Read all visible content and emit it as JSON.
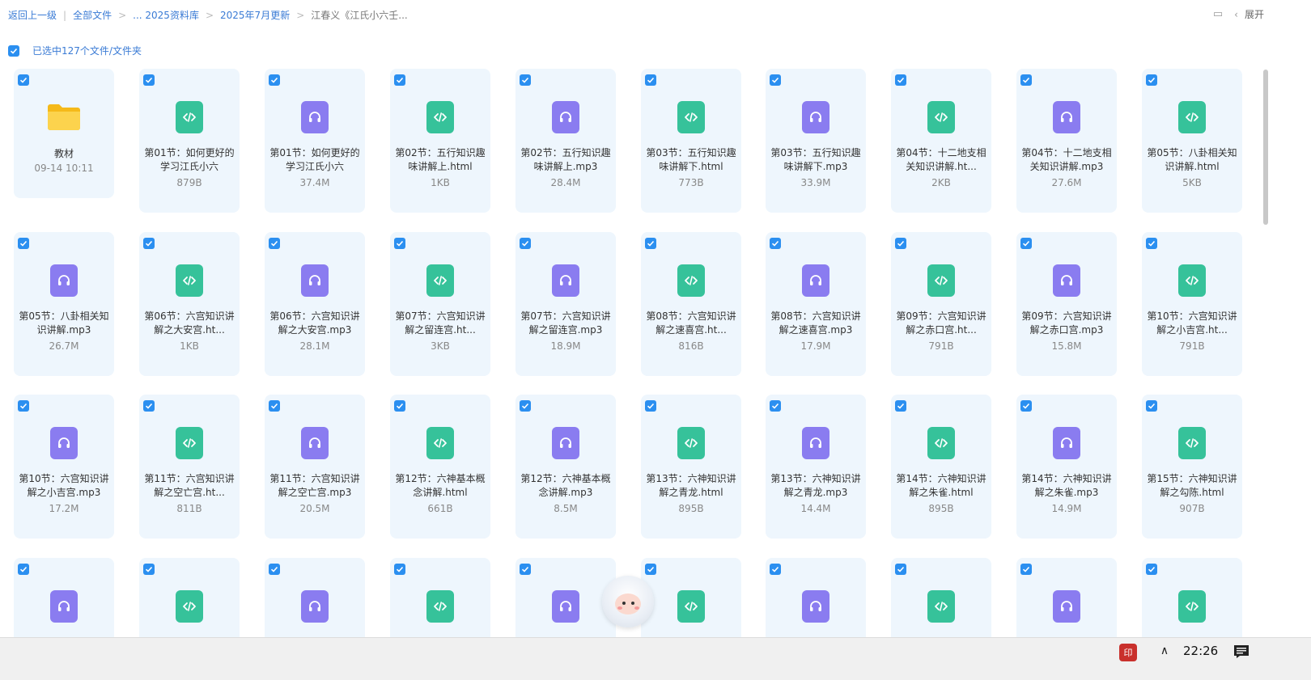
{
  "breadcrumb": {
    "back": "返回上一级",
    "all_files": "全部文件",
    "library": "... 2025资料库",
    "update": "2025年7月更新",
    "current": "江春义《江氏小六壬..."
  },
  "header": {
    "expand_label": "展开"
  },
  "selection": {
    "label": "已选中127个文件/文件夹"
  },
  "files": [
    {
      "type": "folder",
      "name": "教材",
      "meta": "09-14 10:11"
    },
    {
      "type": "html",
      "name": "第01节：如何更好的学习江氏小六",
      "meta": "879B"
    },
    {
      "type": "mp3",
      "name": "第01节：如何更好的学习江氏小六",
      "meta": "37.4M"
    },
    {
      "type": "html",
      "name": "第02节：五行知识趣味讲解上.html",
      "meta": "1KB"
    },
    {
      "type": "mp3",
      "name": "第02节：五行知识趣味讲解上.mp3",
      "meta": "28.4M"
    },
    {
      "type": "html",
      "name": "第03节：五行知识趣味讲解下.html",
      "meta": "773B"
    },
    {
      "type": "mp3",
      "name": "第03节：五行知识趣味讲解下.mp3",
      "meta": "33.9M"
    },
    {
      "type": "html",
      "name": "第04节：十二地支相关知识讲解.ht...",
      "meta": "2KB"
    },
    {
      "type": "mp3",
      "name": "第04节：十二地支相关知识讲解.mp3",
      "meta": "27.6M"
    },
    {
      "type": "html",
      "name": "第05节：八卦相关知识讲解.html",
      "meta": "5KB"
    },
    {
      "type": "mp3",
      "name": "第05节：八卦相关知识讲解.mp3",
      "meta": "26.7M"
    },
    {
      "type": "html",
      "name": "第06节：六宫知识讲解之大安宫.ht...",
      "meta": "1KB"
    },
    {
      "type": "mp3",
      "name": "第06节：六宫知识讲解之大安宫.mp3",
      "meta": "28.1M"
    },
    {
      "type": "html",
      "name": "第07节：六宫知识讲解之留连宫.ht...",
      "meta": "3KB"
    },
    {
      "type": "mp3",
      "name": "第07节：六宫知识讲解之留连宫.mp3",
      "meta": "18.9M"
    },
    {
      "type": "html",
      "name": "第08节：六宫知识讲解之速喜宫.ht...",
      "meta": "816B"
    },
    {
      "type": "mp3",
      "name": "第08节：六宫知识讲解之速喜宫.mp3",
      "meta": "17.9M"
    },
    {
      "type": "html",
      "name": "第09节：六宫知识讲解之赤口宫.ht...",
      "meta": "791B"
    },
    {
      "type": "mp3",
      "name": "第09节：六宫知识讲解之赤口宫.mp3",
      "meta": "15.8M"
    },
    {
      "type": "html",
      "name": "第10节：六宫知识讲解之小吉宫.ht...",
      "meta": "791B"
    },
    {
      "type": "mp3",
      "name": "第10节：六宫知识讲解之小吉宫.mp3",
      "meta": "17.2M"
    },
    {
      "type": "html",
      "name": "第11节：六宫知识讲解之空亡宫.ht...",
      "meta": "811B"
    },
    {
      "type": "mp3",
      "name": "第11节：六宫知识讲解之空亡宫.mp3",
      "meta": "20.5M"
    },
    {
      "type": "html",
      "name": "第12节：六神基本概念讲解.html",
      "meta": "661B"
    },
    {
      "type": "mp3",
      "name": "第12节：六神基本概念讲解.mp3",
      "meta": "8.5M"
    },
    {
      "type": "html",
      "name": "第13节：六神知识讲解之青龙.html",
      "meta": "895B"
    },
    {
      "type": "mp3",
      "name": "第13节：六神知识讲解之青龙.mp3",
      "meta": "14.4M"
    },
    {
      "type": "html",
      "name": "第14节：六神知识讲解之朱雀.html",
      "meta": "895B"
    },
    {
      "type": "mp3",
      "name": "第14节：六神知识讲解之朱雀.mp3",
      "meta": "14.9M"
    },
    {
      "type": "html",
      "name": "第15节：六神知识讲解之勾陈.html",
      "meta": "907B"
    },
    {
      "type": "mp3",
      "name": "",
      "meta": ""
    },
    {
      "type": "html",
      "name": "",
      "meta": ""
    },
    {
      "type": "mp3",
      "name": "",
      "meta": ""
    },
    {
      "type": "html",
      "name": "",
      "meta": ""
    },
    {
      "type": "mp3",
      "name": "",
      "meta": ""
    },
    {
      "type": "html",
      "name": "",
      "meta": ""
    },
    {
      "type": "mp3",
      "name": "",
      "meta": ""
    },
    {
      "type": "html",
      "name": "",
      "meta": ""
    },
    {
      "type": "mp3",
      "name": "",
      "meta": ""
    },
    {
      "type": "html",
      "name": "",
      "meta": ""
    }
  ],
  "taskbar": {
    "badge": "印",
    "time": "22:26"
  },
  "colors": {
    "accent": "#2b8ff0",
    "html_icon": "#36c29a",
    "mp3_icon": "#8a7cf0",
    "card_bg": "#eef6fd"
  }
}
